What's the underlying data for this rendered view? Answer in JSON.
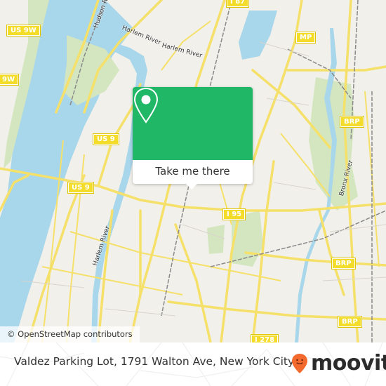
{
  "map": {
    "attribution": "© OpenStreetMap contributors",
    "colors": {
      "land": "#f2f0eb",
      "water": "#a8d6ea",
      "park": "#d4e6c0",
      "road": "#f5e06a",
      "rail": "#8a8a8a"
    },
    "shields": [
      {
        "label": "US 9W",
        "name": "us-9w"
      },
      {
        "label": "9W",
        "name": "us-9w-left"
      },
      {
        "label": "I 87",
        "name": "i-87"
      },
      {
        "label": "MP",
        "name": "mp"
      },
      {
        "label": "US 9",
        "name": "us-9-upper"
      },
      {
        "label": "US 9",
        "name": "us-9-lower"
      },
      {
        "label": "BRP",
        "name": "brp-upper"
      },
      {
        "label": "I 95",
        "name": "i-95"
      },
      {
        "label": "BRP",
        "name": "brp-middle"
      },
      {
        "label": "BRP",
        "name": "brp-lower"
      },
      {
        "label": "I 278",
        "name": "i-278"
      }
    ],
    "water_labels": [
      {
        "label": "Hudson River",
        "name": "hudson-river"
      },
      {
        "label": "Harlem River",
        "name": "harlem-river-1"
      },
      {
        "label": "Harlem River",
        "name": "harlem-river-2"
      },
      {
        "label": "Harlem River",
        "name": "harlem-river-3"
      },
      {
        "label": "Bronx River",
        "name": "bronx-river"
      }
    ]
  },
  "popup": {
    "button_label": "Take me there",
    "icon": "map-pin-icon",
    "color": "#20b866"
  },
  "footer": {
    "place_title": "Valdez Parking Lot, 1791 Walton Ave, New York City",
    "brand": "moovit",
    "brand_color": "#f26a2e"
  }
}
